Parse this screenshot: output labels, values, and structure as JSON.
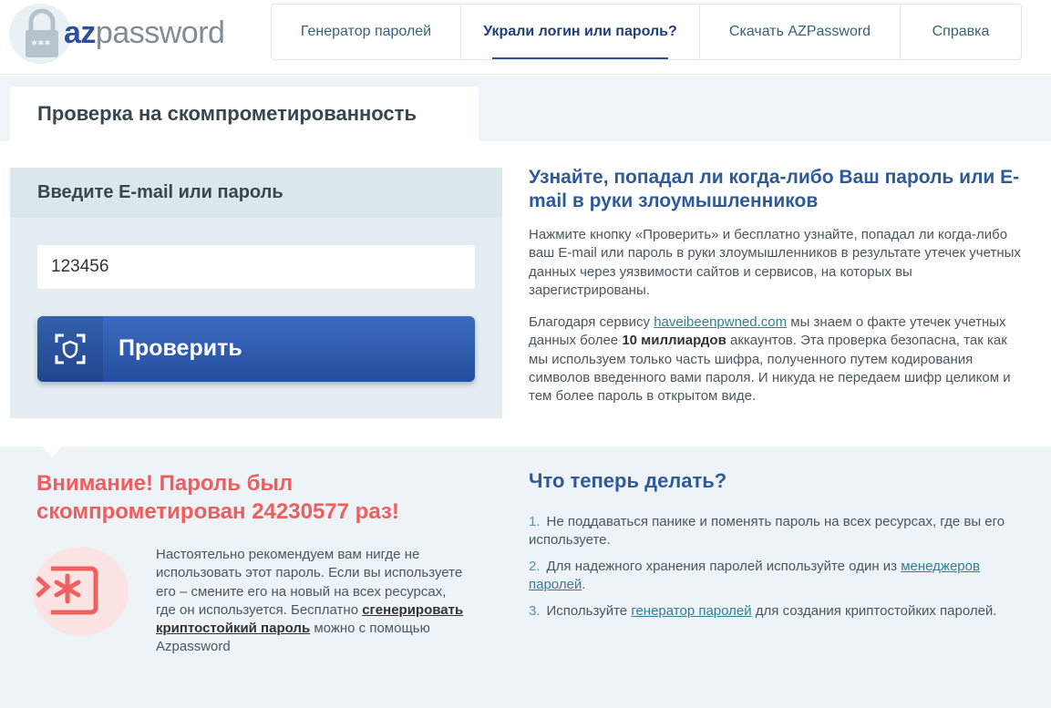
{
  "logo": {
    "brand_bold": "az",
    "brand_rest": "password"
  },
  "nav": {
    "items": [
      {
        "label": "Генератор паролей",
        "active": false
      },
      {
        "label": "Украли логин или пароль?",
        "active": true
      },
      {
        "label": "Скачать AZPassword",
        "active": false
      },
      {
        "label": "Справка",
        "active": false
      }
    ]
  },
  "tab": {
    "title": "Проверка на скомпрометированность"
  },
  "check": {
    "heading": "Введите E-mail или пароль",
    "input_value": "123456",
    "button_label": "Проверить"
  },
  "info": {
    "title": "Узнайте, попадал ли когда-либо Ваш пароль или E-mail в руки злоумышленников",
    "p1": "Нажмите кнопку «Проверить» и бесплатно узнайте, попадал ли когда-либо ваш E-mail или пароль в руки злоумышленников в результате утечек учетных данных через уязвимости сайтов и сервисов, на которых вы зарегистрированы.",
    "p2_before": "Благодаря сервису ",
    "p2_link": "haveibeenpwned.com",
    "p2_middle": " мы знаем о факте утечек учетных данных более ",
    "p2_bold": "10 миллиардов",
    "p2_after": " аккаунтов. Эта проверка безопасна, так как мы используем только часть шифра, полученного путем кодирования символов введенного вами пароля. И никуда не передаем шифр целиком и тем более пароль в открытом виде."
  },
  "warning": {
    "title": "Внимание! Пароль был скомпрометирован 24230577 раз!",
    "text_before": "Настоятельно рекомендуем вам нигде не использовать этот пароль. Если вы используете его – смените его на новый на всех ресурсах, где он используется. Бесплатно ",
    "link": "сгенерировать криптостойкий пароль",
    "text_after": " можно с помощью Azpassword",
    "icon": "password-warning-icon"
  },
  "steps": {
    "title": "Что теперь делать?",
    "items": [
      {
        "num": "1.",
        "before": "Не поддаваться панике и поменять пароль на всех ресурсах, где вы его используете.",
        "link": "",
        "after": ""
      },
      {
        "num": "2.",
        "before": "Для надежного хранения паролей используйте один из ",
        "link": "менеджеров паролей",
        "after": "."
      },
      {
        "num": "3.",
        "before": "Используйте ",
        "link": "генератор паролей",
        "after": " для создания криптостойких паролей."
      }
    ]
  },
  "colors": {
    "brand_blue": "#2c4fa0",
    "warning_red": "#ef5d5d",
    "link_teal": "#2f7e9a",
    "panel_bg": "#e3edf2"
  }
}
